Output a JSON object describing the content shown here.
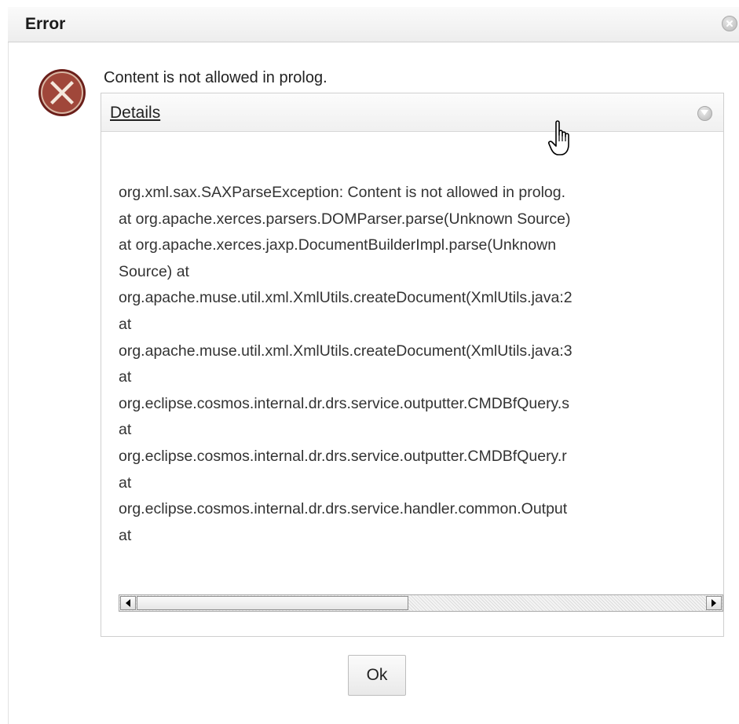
{
  "dialog": {
    "title": "Error",
    "message": "Content is not allowed in prolog.",
    "details_label": "Details",
    "ok_label": "Ok"
  },
  "icons": {
    "close": "close-icon",
    "error": "error-x-icon",
    "toggle": "chevron-down-icon",
    "cursor": "hand-pointer-icon"
  },
  "stack_trace": [
    "org.xml.sax.SAXParseException: Content is not allowed in prolog.",
    "at org.apache.xerces.parsers.DOMParser.parse(Unknown Source)",
    "at org.apache.xerces.jaxp.DocumentBuilderImpl.parse(Unknown",
    "Source) at",
    "org.apache.muse.util.xml.XmlUtils.createDocument(XmlUtils.java:2",
    "at",
    "org.apache.muse.util.xml.XmlUtils.createDocument(XmlUtils.java:3",
    "at",
    "org.eclipse.cosmos.internal.dr.drs.service.outputter.CMDBfQuery.s",
    "at",
    "org.eclipse.cosmos.internal.dr.drs.service.outputter.CMDBfQuery.r",
    "at",
    "org.eclipse.cosmos.internal.dr.drs.service.handler.common.Output",
    "at"
  ],
  "colors": {
    "error_icon_ring": "#6b1f1a",
    "error_icon_fill": "#a0473a",
    "error_icon_mark": "#f4e8dc"
  }
}
